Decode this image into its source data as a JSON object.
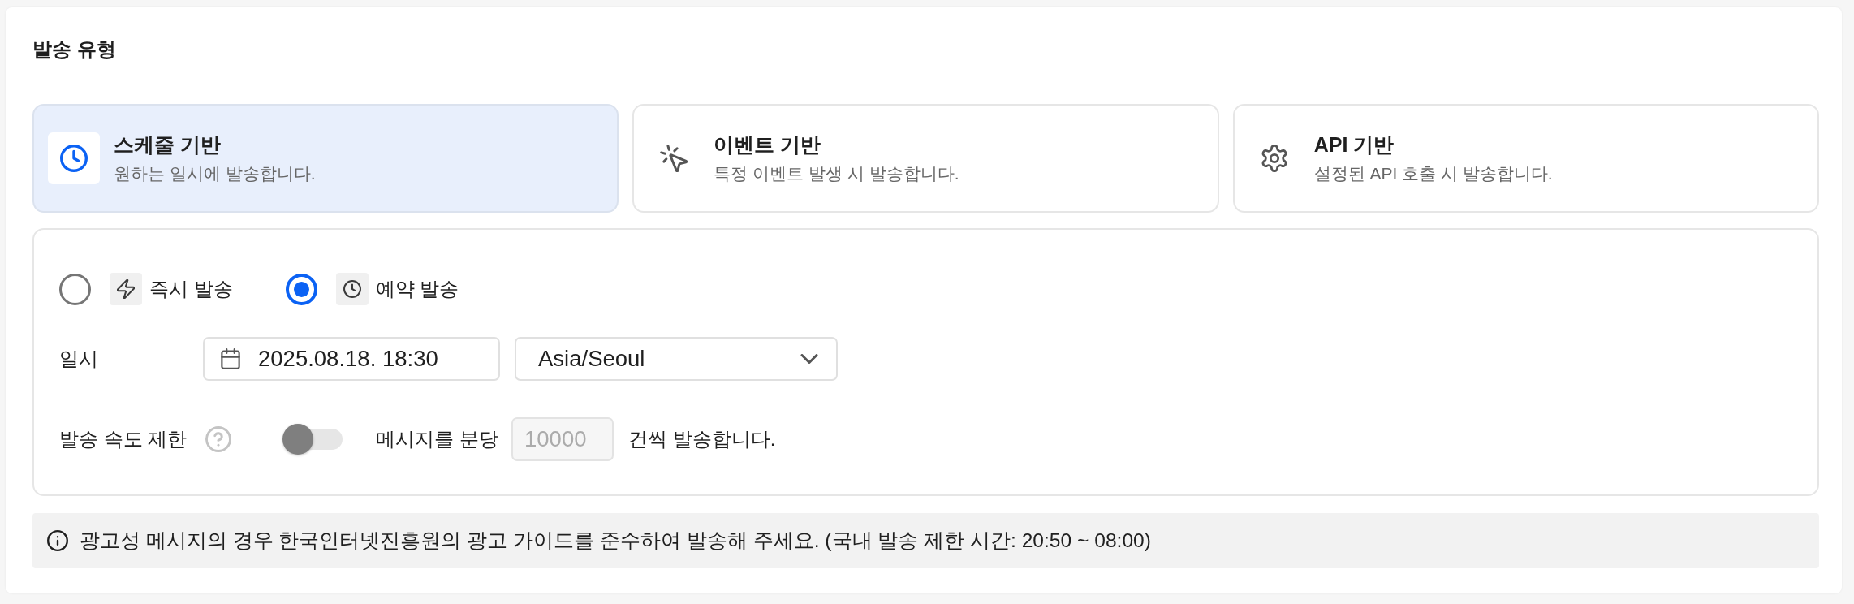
{
  "section": {
    "title": "발송 유형"
  },
  "send_types": [
    {
      "kind": "schedule",
      "title": "스케줄 기반",
      "description": "원하는 일시에 발송합니다.",
      "selected": true
    },
    {
      "kind": "event",
      "title": "이벤트 기반",
      "description": "특정 이벤트 발생 시 발송합니다.",
      "selected": false
    },
    {
      "kind": "api",
      "title": "API 기반",
      "description": "설정된 API 호출 시 발송합니다.",
      "selected": false
    }
  ],
  "send_modes": [
    {
      "kind": "instant",
      "label": "즉시 발송",
      "selected": false
    },
    {
      "kind": "scheduled",
      "label": "예약 발송",
      "selected": true
    }
  ],
  "datetime": {
    "label": "일시",
    "value": "2025.08.18. 18:30",
    "timezone": "Asia/Seoul"
  },
  "rate_limit": {
    "label": "발송 속도 제한",
    "on": false,
    "prefix": "메시지를 분당",
    "count_field": {
      "placeholder": "10000",
      "disabled": true
    },
    "suffix": "건씩 발송합니다."
  },
  "notice": {
    "text": "광고성 메시지의 경우 한국인터넷진흥원의 광고 가이드를 준수하여 발송해 주세요. (국내 발송 제한 시간: 20:50 ~ 08:00)"
  }
}
